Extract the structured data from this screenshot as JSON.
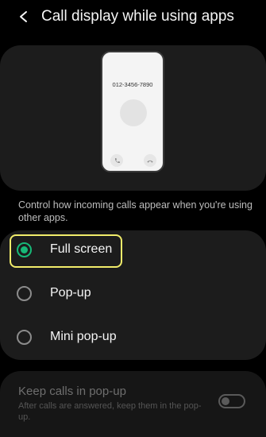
{
  "header": {
    "title": "Call display while using apps",
    "back_icon": "chevron-left-icon"
  },
  "preview": {
    "phone_number": "012-3456-7890",
    "accept_icon": "phone-icon",
    "decline_icon": "phone-hangup-icon"
  },
  "description": "Control how incoming calls appear when you're using other apps.",
  "options": [
    {
      "label": "Full screen",
      "selected": true
    },
    {
      "label": "Pop-up",
      "selected": false
    },
    {
      "label": "Mini pop-up",
      "selected": false
    }
  ],
  "keep_calls": {
    "title": "Keep calls in pop-up",
    "subtitle": "After calls are answered, keep them in the pop-up.",
    "enabled": false,
    "disabled_state": true
  },
  "colors": {
    "accent": "#17b978",
    "highlight": "#f1ec6a",
    "background": "#000000",
    "card": "#1c1c1c"
  }
}
